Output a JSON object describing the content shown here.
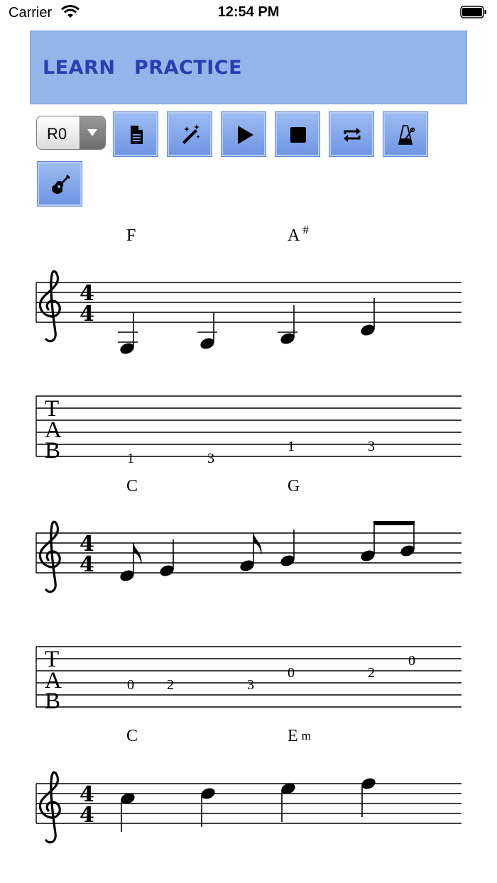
{
  "status_bar": {
    "carrier": "Carrier",
    "time": "12:54 PM"
  },
  "tabs": [
    {
      "label": "LEARN"
    },
    {
      "label": "PRACTICE"
    }
  ],
  "toolbar": {
    "select_value": "R0",
    "buttons": [
      "document-icon",
      "magic-wand-icon",
      "play-icon",
      "stop-icon",
      "repeat-icon",
      "metronome-icon",
      "guitar-icon"
    ]
  },
  "systems": [
    {
      "chords": [
        "F",
        "A#"
      ],
      "time_signature": [
        "4",
        "4"
      ],
      "tab_numbers": [
        "1",
        "3",
        "1",
        "3"
      ]
    },
    {
      "chords": [
        "C",
        "G"
      ],
      "time_signature": [
        "4",
        "4"
      ],
      "tab_numbers": [
        "0",
        "2",
        "3",
        "0",
        "2",
        "0"
      ]
    },
    {
      "chords": [
        "C",
        "Em"
      ],
      "time_signature": [
        "4",
        "4"
      ],
      "tab_numbers": []
    }
  ],
  "colors": {
    "tab_bar": "#94b5ea",
    "tab_text": "#2b3db0",
    "button": "#7fa3e8"
  }
}
